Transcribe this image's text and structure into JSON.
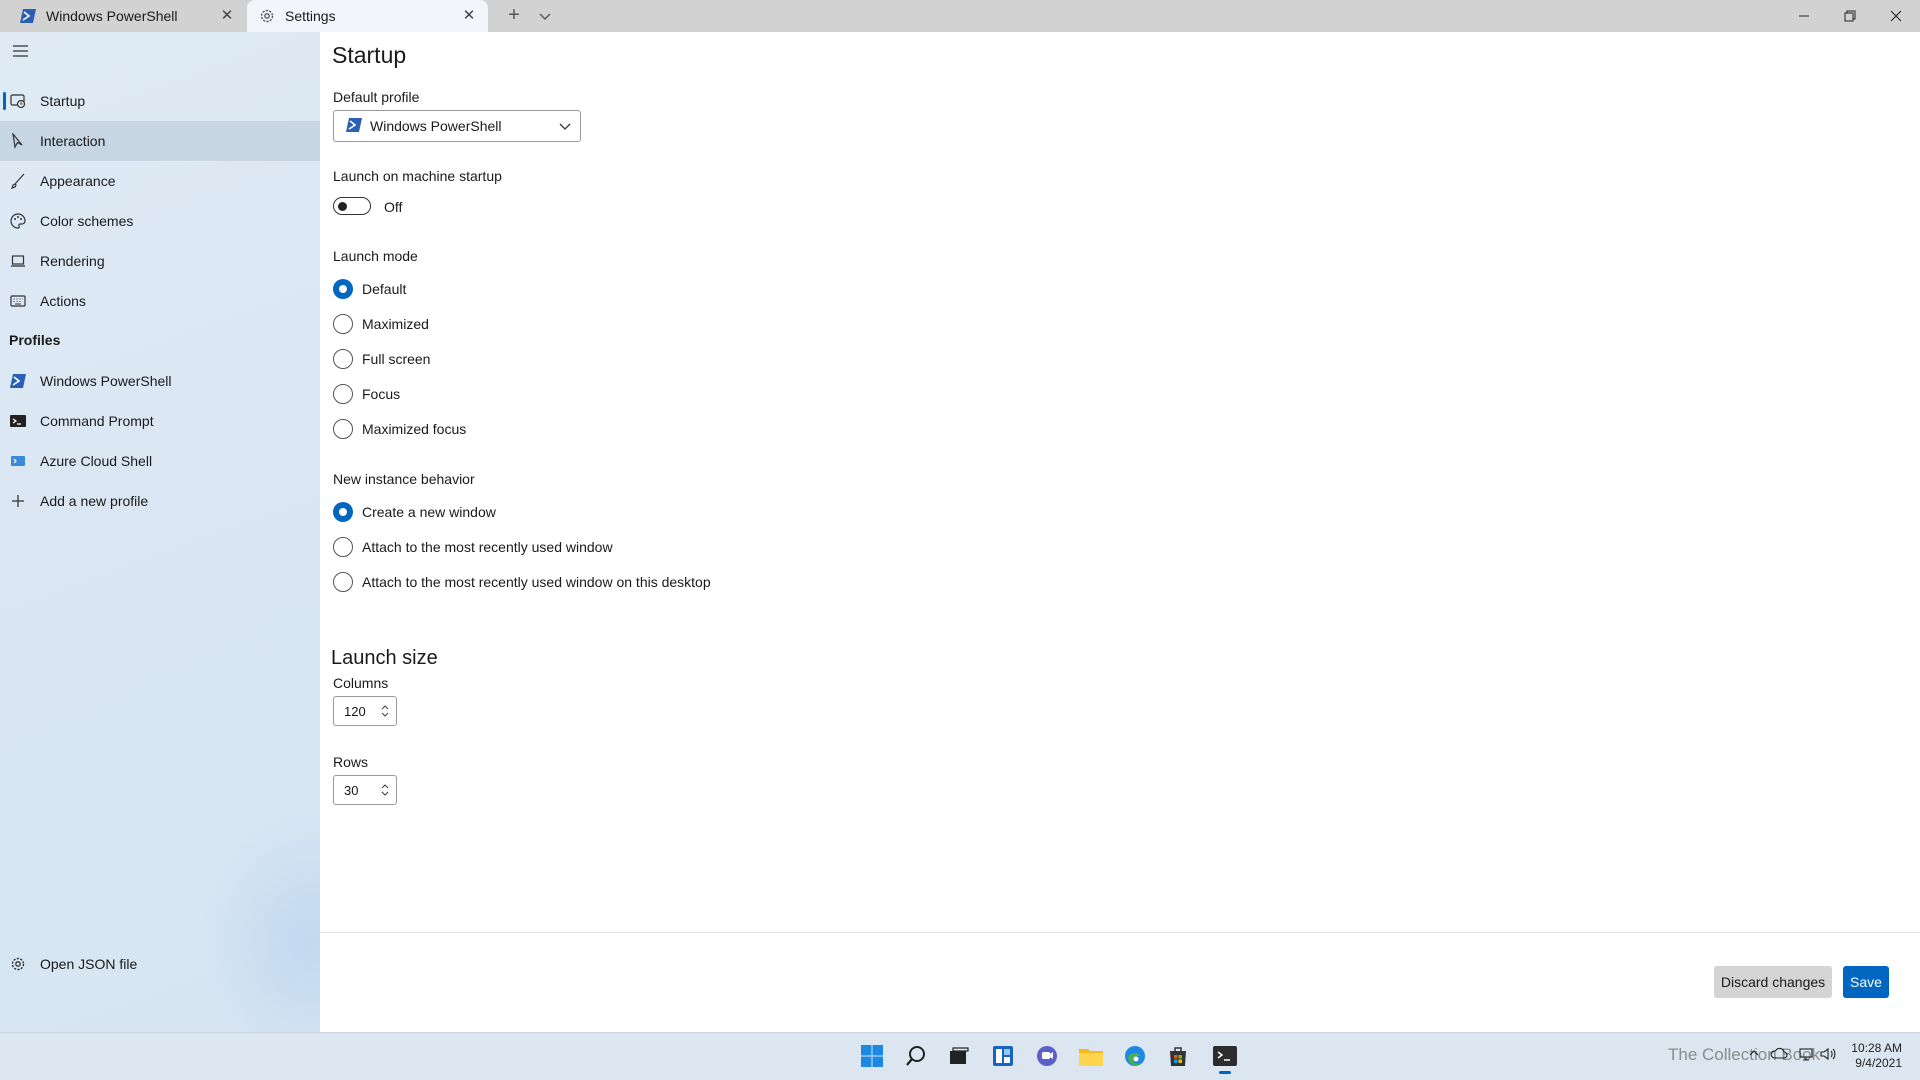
{
  "tabs": [
    {
      "label": "Windows PowerShell",
      "icon": "powershell-icon"
    },
    {
      "label": "Settings",
      "icon": "gear-icon"
    }
  ],
  "sidebar": {
    "items": [
      {
        "label": "Startup",
        "icon": "startup-icon"
      },
      {
        "label": "Interaction",
        "icon": "cursor-icon"
      },
      {
        "label": "Appearance",
        "icon": "brush-icon"
      },
      {
        "label": "Color schemes",
        "icon": "palette-icon"
      },
      {
        "label": "Rendering",
        "icon": "laptop-icon"
      },
      {
        "label": "Actions",
        "icon": "keyboard-icon"
      }
    ],
    "profiles_header": "Profiles",
    "profiles": [
      {
        "label": "Windows PowerShell",
        "icon": "powershell-icon"
      },
      {
        "label": "Command Prompt",
        "icon": "cmd-icon"
      },
      {
        "label": "Azure Cloud Shell",
        "icon": "azure-icon"
      },
      {
        "label": "Add a new profile",
        "icon": "plus-icon"
      }
    ],
    "open_json": {
      "label": "Open JSON file",
      "icon": "gear-icon"
    }
  },
  "main": {
    "title": "Startup",
    "default_profile": {
      "label": "Default profile",
      "value": "Windows PowerShell"
    },
    "launch_on_startup": {
      "label": "Launch on machine startup",
      "state": "Off"
    },
    "launch_mode": {
      "label": "Launch mode",
      "options": [
        "Default",
        "Maximized",
        "Full screen",
        "Focus",
        "Maximized focus"
      ],
      "selected": "Default"
    },
    "new_instance": {
      "label": "New instance behavior",
      "options": [
        "Create a new window",
        "Attach to the most recently used window",
        "Attach to the most recently used window on this desktop"
      ],
      "selected": "Create a new window"
    },
    "launch_size": {
      "title": "Launch size",
      "columns_label": "Columns",
      "columns_value": "120",
      "rows_label": "Rows",
      "rows_value": "30"
    },
    "buttons": {
      "discard": "Discard changes",
      "save": "Save"
    }
  },
  "taskbar": {
    "clock_time": "10:28 AM",
    "clock_date": "9/4/2021",
    "watermark": "The Collection Book"
  },
  "colors": {
    "accent": "#0067c0",
    "sidebar_bg": "#d9e6f2",
    "tabbar_bg": "#d2d2d2"
  }
}
